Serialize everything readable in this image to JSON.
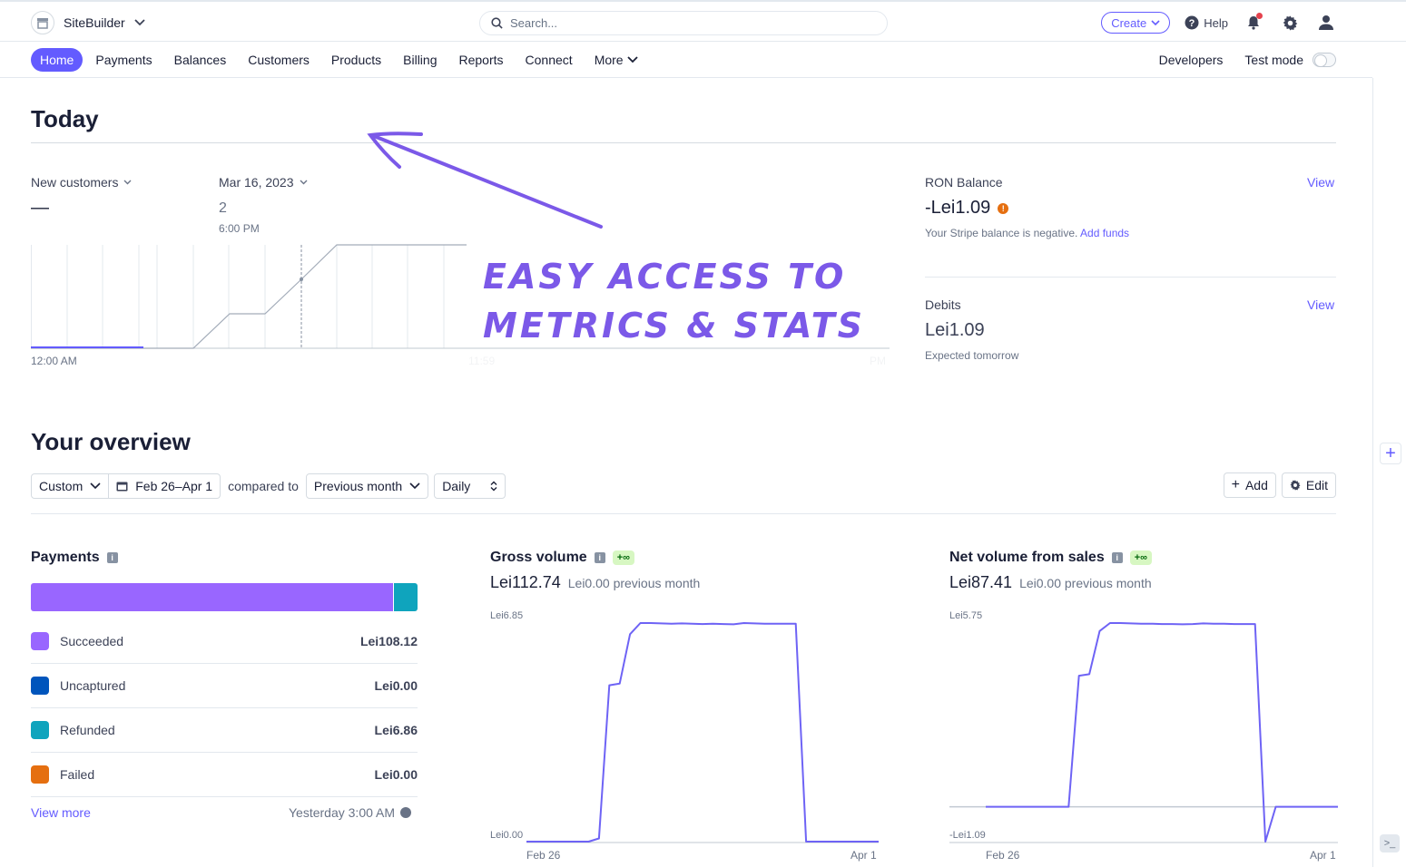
{
  "header": {
    "brand": "SiteBuilder",
    "search_placeholder": "Search...",
    "create_label": "Create",
    "help_label": "Help"
  },
  "nav": {
    "items": [
      "Home",
      "Payments",
      "Balances",
      "Customers",
      "Products",
      "Billing",
      "Reports",
      "Connect"
    ],
    "more_label": "More",
    "developers_label": "Developers",
    "test_mode_label": "Test mode"
  },
  "today": {
    "title": "Today",
    "metric_select": "New customers",
    "metric_value": "—",
    "date_select": "Mar 16, 2023",
    "compare_value": "2",
    "compare_time": "6:00 PM",
    "x_start": "12:00 AM",
    "x_mid": "11:59",
    "x_end": "PM"
  },
  "annotation": {
    "line1": "EASY ACCESS TO",
    "line2": "METRICS & STATS"
  },
  "balance": {
    "title": "RON Balance",
    "view_label": "View",
    "amount": "-Lei1.09",
    "note": "Your Stripe balance is negative.",
    "add_funds_label": "Add funds",
    "debits_title": "Debits",
    "debits_view_label": "View",
    "debits_amount": "Lei1.09",
    "debits_note": "Expected tomorrow"
  },
  "overview": {
    "title": "Your overview",
    "range_select": "Custom",
    "date_range": "Feb 26–Apr 1",
    "compared_to": "compared to",
    "compare_select": "Previous month",
    "interval_select": "Daily",
    "add_label": "Add",
    "edit_label": "Edit"
  },
  "payments": {
    "title": "Payments",
    "rows": [
      {
        "label": "Succeeded",
        "amount": "Lei108.12",
        "color": "#9966ff"
      },
      {
        "label": "Uncaptured",
        "amount": "Lei0.00",
        "color": "#0055bc"
      },
      {
        "label": "Refunded",
        "amount": "Lei6.86",
        "color": "#0fa4bd"
      },
      {
        "label": "Failed",
        "amount": "Lei0.00",
        "color": "#e56f10"
      }
    ],
    "bar_fractions": [
      0.94,
      0.06
    ],
    "view_more_label": "View more",
    "updated": "Yesterday 3:00 AM"
  },
  "gross": {
    "title": "Gross volume",
    "badge": "+∞",
    "amount": "Lei112.74",
    "previous": "Lei0.00 previous month",
    "y_max_label": "Lei6.85",
    "y_min_label": "Lei0.00",
    "x_start": "Feb 26",
    "x_end": "Apr 1"
  },
  "net": {
    "title": "Net volume from sales",
    "badge": "+∞",
    "amount": "Lei87.41",
    "previous": "Lei0.00 previous month",
    "y_max_label": "Lei5.75",
    "y_min_label": "-Lei1.09",
    "x_start": "Feb 26",
    "x_end": "Apr 1"
  },
  "chart_data": [
    {
      "type": "line",
      "title": "Gross volume",
      "x": [
        "Feb 26",
        "Apr 1"
      ],
      "ylim": [
        0,
        6.85
      ],
      "series": [
        {
          "values": [
            0,
            0,
            0,
            0,
            0,
            0,
            0,
            0.1,
            4.9,
            4.95,
            6.5,
            6.85,
            6.85,
            6.84,
            6.83,
            6.84,
            6.83,
            6.82,
            6.83,
            6.82,
            6.81,
            6.85,
            6.84,
            6.83,
            6.83,
            6.83,
            6.83,
            0,
            0,
            0,
            0,
            0,
            0,
            0,
            0
          ]
        }
      ]
    },
    {
      "type": "line",
      "title": "Net volume from sales",
      "x": [
        "Feb 26",
        "Apr 1"
      ],
      "ylim": [
        -1.09,
        5.75
      ],
      "series": [
        {
          "values": [
            0,
            0,
            0,
            0,
            0,
            0,
            0,
            0,
            0,
            4.1,
            4.15,
            5.5,
            5.75,
            5.75,
            5.74,
            5.73,
            5.73,
            5.72,
            5.72,
            5.71,
            5.72,
            5.74,
            5.73,
            5.73,
            5.72,
            5.72,
            5.72,
            -1.09,
            0,
            0,
            0,
            0,
            0,
            0,
            0
          ]
        }
      ]
    }
  ]
}
